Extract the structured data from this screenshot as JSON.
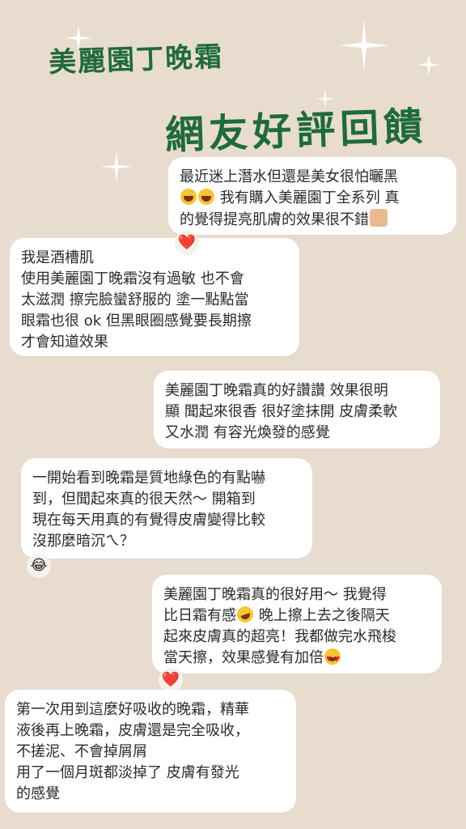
{
  "title": {
    "line1": "美麗園丁晚霜",
    "line2": "網友好評回饋"
  },
  "messages": [
    {
      "lines": [
        "最近迷上潛水但還是美女很怕曬黑",
        "我有購入美麗園丁全系列 真",
        "的覺得提亮肌膚的效果很不錯"
      ],
      "emojis": [
        "grinning-squinting-face",
        "grinning-squinting-face",
        "thumbs-up"
      ]
    },
    {
      "reaction": "❤️",
      "lines": [
        "我是酒槽肌",
        "使用美麗園丁晚霜沒有過敏 也不會",
        "太滋潤 擦完臉蠻舒服的 塗一點點當",
        "眼霜也很 ok 但黑眼圈感覺要長期擦",
        "才會知道效果"
      ]
    },
    {
      "lines": [
        "美麗園丁晚霜真的好讚讚 效果很明",
        "顯 聞起來很香 很好塗抹開 皮膚柔軟",
        "又水潤 有容光煥發的感覺"
      ]
    },
    {
      "reaction": "😂",
      "lines": [
        "一開始看到晚霜是質地綠色的有點嚇",
        "到，但聞起來真的很天然～ 開箱到",
        "現在每天用真的有覺得皮膚變得比較",
        "沒那麼暗沉ㄟ？"
      ]
    },
    {
      "lines": [
        "美麗園丁晚霜真的很好用～ 我覺得",
        "比日霜有感",
        "晚上擦上去之後隔天",
        "起來皮膚真的超亮！我都做完水飛梭",
        "當天擦，效果感覺有加倍"
      ],
      "emojis": [
        "rolling-on-floor-laughing",
        "smiling-face-with-heart-eyes"
      ]
    },
    {
      "reaction": "❤️",
      "lines": [
        "第一次用到這麼好吸收的晚霜，精華",
        "液後再上晚霜，皮膚還是完全吸收，",
        "不搓泥、不會掉屑屑",
        "用了一個月斑都淡掉了 皮膚有發光",
        "的感覺"
      ]
    }
  ],
  "colors": {
    "background": "#e8dccf",
    "title": "#1f6b3a",
    "bubble": "#ffffff",
    "heart": "#e2253a"
  }
}
